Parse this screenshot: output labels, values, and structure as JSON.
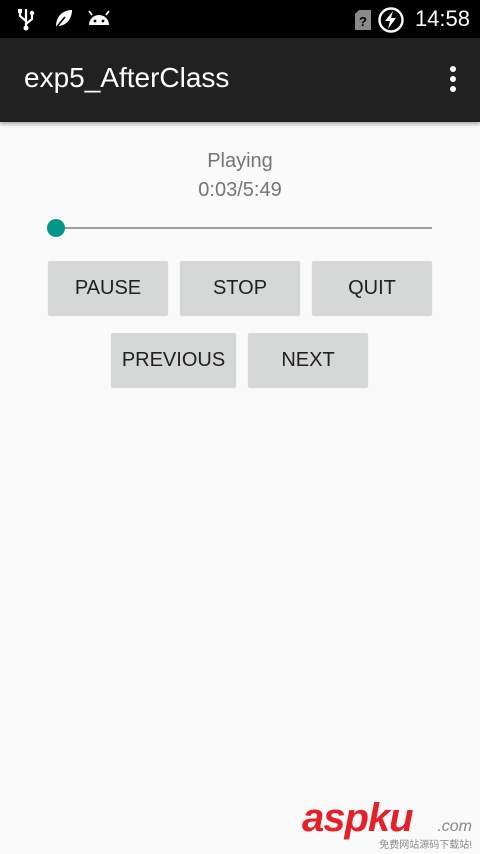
{
  "status_bar": {
    "time": "14:58",
    "icons": [
      "usb-icon",
      "leaf-icon",
      "android-icon",
      "no-sim-icon",
      "battery-charging-icon"
    ]
  },
  "app_bar": {
    "title": "exp5_AfterClass",
    "overflow_icon": "overflow-menu-icon"
  },
  "player": {
    "state": "Playing",
    "progress_text": "0:03/5:49",
    "seek_fraction": 0.009,
    "accent_color": "#009688"
  },
  "buttons": {
    "pause": "PAUSE",
    "stop": "STOP",
    "quit": "QUIT",
    "previous": "PREVIOUS",
    "next": "NEXT"
  },
  "watermark": {
    "brand": "aspku",
    "domain": ".com",
    "tagline": "免费网站源码下载站!"
  }
}
